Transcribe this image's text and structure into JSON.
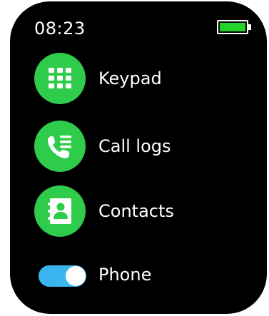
{
  "status_bar": {
    "time": "08:23",
    "battery_color": "#22d42a"
  },
  "menu": {
    "items": [
      {
        "label": "Keypad",
        "icon": "keypad-icon"
      },
      {
        "label": "Call logs",
        "icon": "call-log-icon"
      },
      {
        "label": "Contacts",
        "icon": "contacts-icon"
      }
    ]
  },
  "phone_toggle": {
    "label": "Phone",
    "enabled": true,
    "on_color": "#3ab5f0"
  },
  "theme": {
    "background": "#000000",
    "accent": "#2fcc4b"
  }
}
